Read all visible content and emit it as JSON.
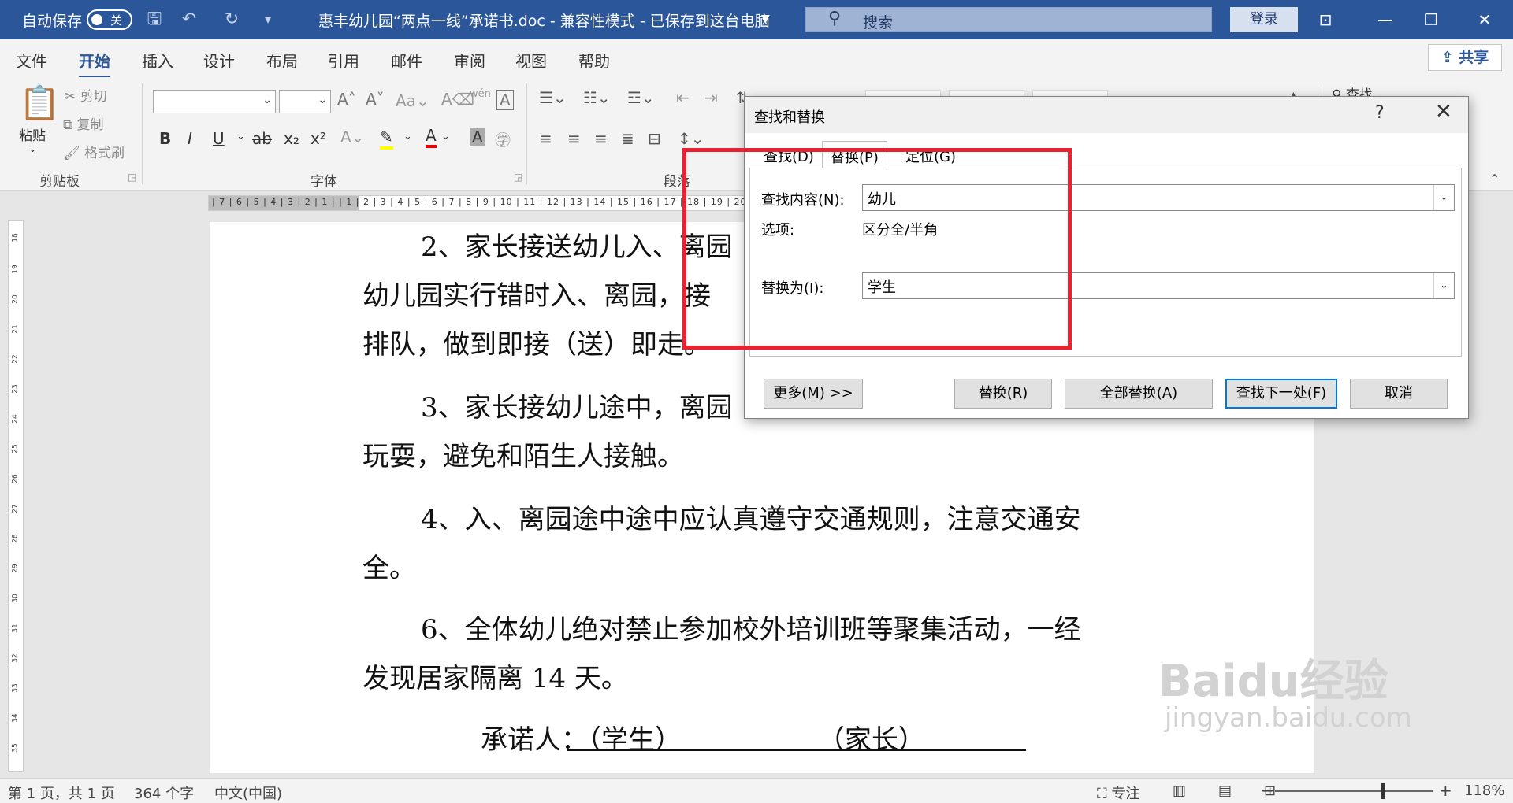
{
  "titlebar": {
    "autosave_label": "自动保存",
    "autosave_state": "关",
    "document_title": "惠丰幼儿园“两点一线”承诺书.doc  -  兼容性模式  -  已保存到这台电脑",
    "search_placeholder": "搜索",
    "login_label": "登录",
    "minimize": "—",
    "restore": "❐",
    "close": "✕"
  },
  "menu": {
    "tabs": [
      "文件",
      "开始",
      "插入",
      "设计",
      "布局",
      "引用",
      "邮件",
      "审阅",
      "视图",
      "帮助"
    ],
    "active": "开始",
    "share": "共享"
  },
  "ribbon": {
    "clipboard": {
      "paste": "粘贴",
      "cut": "剪切",
      "copy": "复制",
      "format_painter": "格式刷",
      "group": "剪贴板"
    },
    "font": {
      "group": "字体",
      "bold": "B",
      "italic": "I",
      "underline": "U",
      "strike": "ab",
      "sub": "x₂",
      "sup": "x²"
    },
    "paragraph": {
      "group": "段落"
    },
    "find_label": "查找"
  },
  "document": {
    "paragraphs": [
      "2、家长接送幼儿入、离园",
      "幼儿园实行错时入、离园，接",
      "排队，做到即接（送）即走。",
      "3、家长接幼儿途中，离园",
      "玩耍，避免和陌生人接触。",
      "4、入、离园途中途中应认真遵守交通规则，注意交通安",
      "全。",
      "6、全体幼儿绝对禁止参加校外培训班等聚集活动，一经",
      "发现居家隔离 14 天。",
      "承诺人：（学生）                （家长）"
    ]
  },
  "dialog": {
    "title": "查找和替换",
    "help": "?",
    "close": "✕",
    "tabs": [
      "查找(D)",
      "替换(P)",
      "定位(G)"
    ],
    "active_tab": "替换(P)",
    "find_label": "查找内容(N):",
    "find_value": "幼儿",
    "options_label": "选项:",
    "options_value": "区分全/半角",
    "replace_label": "替换为(I):",
    "replace_value": "学生",
    "buttons": {
      "more": "更多(M) >>",
      "replace": "替换(R)",
      "replace_all": "全部替换(A)",
      "find_next": "查找下一处(F)",
      "cancel": "取消"
    }
  },
  "statusbar": {
    "page": "第 1 页，共 1 页",
    "words": "364 个字",
    "language": "中文(中国)",
    "focus": "专注",
    "zoom": "118%"
  },
  "watermark": {
    "brand": "Baidu经验",
    "url": "jingyan.baidu.com"
  },
  "colors": {
    "title_bar": "#2b579a",
    "highlight_box": "#e8222f",
    "primary_button": "#0078d7"
  }
}
